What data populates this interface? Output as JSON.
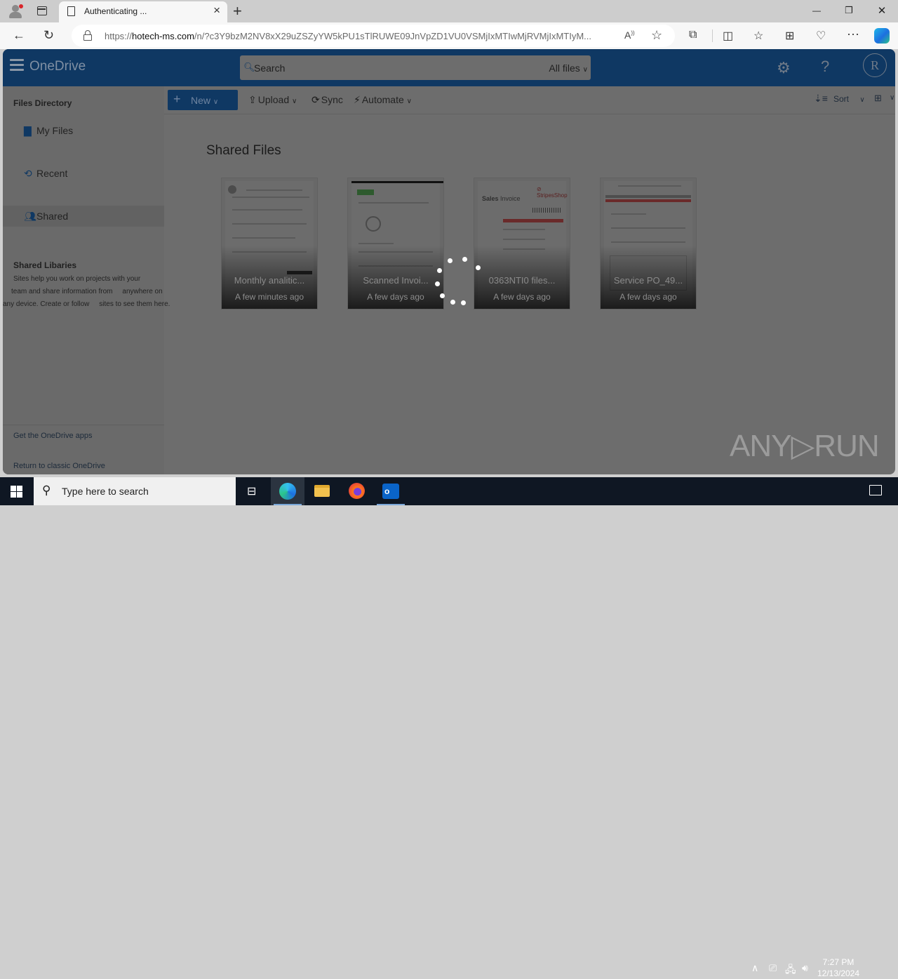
{
  "browser": {
    "tab_title": "Authenticating ...",
    "url_prefix": "https://",
    "url_host": "hotech-ms.com",
    "url_rest": "/n/?c3Y9bzM2NV8xX29uZSZyYW5kPU1sTlRUWE09JnVpZD1VU0VSMjIxMTIwMjRVMjIxMTIyM...",
    "window_controls": {
      "minimize": "—",
      "restore": "❐",
      "close": "✕"
    }
  },
  "header": {
    "brand": "OneDrive",
    "search_placeholder": "Search",
    "search_scope": "All files",
    "avatar_initial": "R"
  },
  "sidebar": {
    "title": "Files Directory",
    "items": [
      {
        "label": "My Files",
        "icon": "folder-icon"
      },
      {
        "label": "Recent",
        "icon": "history-icon"
      },
      {
        "label": "Shared",
        "icon": "people-icon",
        "active": true
      }
    ],
    "libraries_title": "Shared Libaries",
    "libraries_desc": [
      "Sites help you work on projects with your",
      "team and share information from     anywhere on",
      "any device. Create or follow     sites to see them here."
    ],
    "links": [
      "Get the OneDrive apps",
      "Return to classic OneDrive"
    ]
  },
  "commandbar": {
    "new_label": "New",
    "upload_label": "Upload",
    "sync_label": "Sync",
    "automate_label": "Automate",
    "sort_label": "Sort"
  },
  "main": {
    "title": "Shared Files",
    "files": [
      {
        "name": "Monthly analitic...",
        "date": "A few minutes ago"
      },
      {
        "name": "Scanned Invoi...",
        "date": "A few days ago"
      },
      {
        "name": "0363NTI0 files...",
        "date": "A few days ago"
      },
      {
        "name": "Service PO_49...",
        "date": "A few days ago"
      }
    ]
  },
  "watermark": "ANY▷RUN",
  "taskbar": {
    "search_placeholder": "Type here to search",
    "time": "7:27 PM",
    "date": "12/13/2024"
  }
}
